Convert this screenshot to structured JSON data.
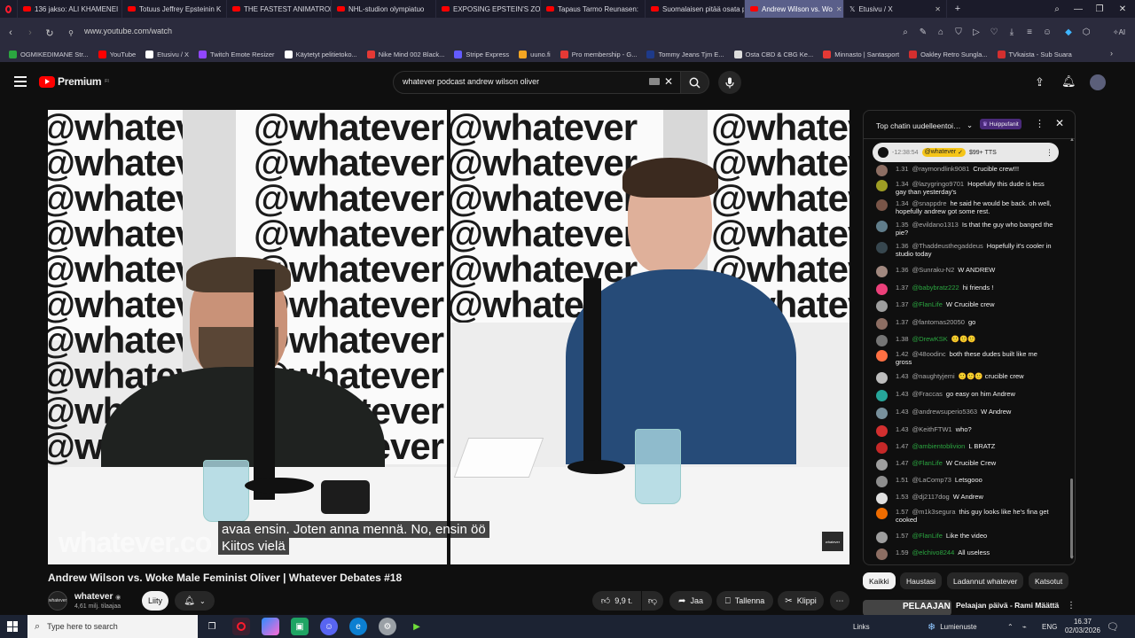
{
  "browser": {
    "tabs": [
      {
        "label": "136 jakso: ALI KHAMENEI",
        "active": false
      },
      {
        "label": "Totuus Jeffrey Epsteinin K",
        "active": false
      },
      {
        "label": "THE FASTEST ANIMATRON",
        "active": false
      },
      {
        "label": "NHL-studion olympiatuo",
        "active": false
      },
      {
        "label": "EXPOSING EPSTEIN'S ZOR",
        "active": false
      },
      {
        "label": "Tapaus Tarmo Reunasen:",
        "active": false
      },
      {
        "label": "Suomalaisen pitää osata p",
        "active": false
      },
      {
        "label": "Andrew Wilson vs. Wo",
        "active": true
      },
      {
        "label": "Etusivu / X",
        "active": false
      }
    ],
    "url": "www.youtube.com/watch",
    "bookmarks": [
      {
        "label": "OGMIKEDIMANE Str...",
        "color": "#2ba640"
      },
      {
        "label": "YouTube",
        "color": "#ff0000"
      },
      {
        "label": "Etusivu / X",
        "color": "#ffffff"
      },
      {
        "label": "Twitch Emote Resizer",
        "color": "#9146ff"
      },
      {
        "label": "Käytetyt pelitietoko...",
        "color": "#ffffff"
      },
      {
        "label": "Nike Mind 002 Black...",
        "color": "#e53935"
      },
      {
        "label": "Stripe Express",
        "color": "#635bff"
      },
      {
        "label": "uuno.fi",
        "color": "#f5a623"
      },
      {
        "label": "Pro membership - G...",
        "color": "#e53935"
      },
      {
        "label": "Tommy Jeans Tjm E...",
        "color": "#1e3a8a"
      },
      {
        "label": "Osta CBD & CBG Ke...",
        "color": "#dddddd"
      },
      {
        "label": "Minnasto | Santasport",
        "color": "#e53935"
      },
      {
        "label": "Oakley Retro Sungla...",
        "color": "#d32f2f"
      },
      {
        "label": "TVkaista - Sub Suara",
        "color": "#d32f2f"
      }
    ]
  },
  "youtube": {
    "logo_text": "Premium",
    "logo_sup": "FI",
    "search_value": "whatever podcast andrew wilson oliver"
  },
  "video": {
    "wall_text": "@whatever",
    "watermark": "whatever.co",
    "captions": [
      "avaa ensin. Joten anna mennä. No, ensin öö",
      "Kiitos vielä"
    ],
    "title": "Andrew Wilson vs. Woke Male Feminist Oliver | Whatever Debates #18",
    "channel_name": "whatever",
    "channel_avatar_text": "whatever",
    "subscribers": "4,61 milj. tilaajaa",
    "join_label": "Liity",
    "likes": "9,9 t.",
    "share_label": "Jaa",
    "save_label": "Tallenna",
    "clip_label": "Klippi",
    "corner_logo": "whatever"
  },
  "chat": {
    "header": "Top chatin uudelleentoisto",
    "header_badge": "Huippufanit",
    "pinned": {
      "time": "-12:38:54",
      "author": "@whatever",
      "text": "$99+ TTS"
    },
    "messages": [
      {
        "time": "1.31",
        "author": "@raymondlink9081",
        "text": "Crucible crew!!!",
        "color": "#8d6e63",
        "member": false
      },
      {
        "time": "1.34",
        "author": "@lazygringo9701",
        "text": "Hopefully this dude is less gay than yesterday's",
        "color": "#9e9d24",
        "member": false
      },
      {
        "time": "1.34",
        "author": "@snappdre",
        "text": "he said he would be back. oh well, hopefully andrew got some rest.",
        "color": "#795548",
        "member": false
      },
      {
        "time": "1.35",
        "author": "@evildano1313",
        "text": "Is that the guy who banged the pie?",
        "color": "#607d8b",
        "member": false
      },
      {
        "time": "1.36",
        "author": "@Thaddeusthegaddeus",
        "text": "Hopefully it's cooler in studio today",
        "color": "#37474f",
        "member": false
      },
      {
        "time": "1.36",
        "author": "@Sunraku-N2",
        "text": "W ANDREW",
        "color": "#a1887f",
        "member": false
      },
      {
        "time": "1.37",
        "author": "@babybratz222",
        "text": "hi friends !",
        "color": "#ec407a",
        "member": true
      },
      {
        "time": "1.37",
        "author": "@FlanLife",
        "text": "W Crucible crew",
        "color": "#9e9e9e",
        "member": true
      },
      {
        "time": "1.37",
        "author": "@fantomas20050",
        "text": "go",
        "color": "#8d6e63",
        "member": false
      },
      {
        "time": "1.38",
        "author": "@DrewKSK",
        "text": "🙂🙂🙂",
        "color": "#757575",
        "member": true
      },
      {
        "time": "1.42",
        "author": "@48oodinc",
        "text": "both these dudes built like me gross",
        "color": "#ff7043",
        "member": false
      },
      {
        "time": "1.43",
        "author": "@naughtyjemi",
        "text": "🙂🙂🙂 crucible crew",
        "color": "#bdbdbd",
        "member": false
      },
      {
        "time": "1.43",
        "author": "@Fraccas",
        "text": "go easy on him Andrew",
        "color": "#26a69a",
        "member": false
      },
      {
        "time": "1.43",
        "author": "@andrewsuperio5363",
        "text": "W Andrew",
        "color": "#78909c",
        "member": false
      },
      {
        "time": "1.43",
        "author": "@KeithFTW1",
        "text": "who?",
        "color": "#d32f2f",
        "member": false
      },
      {
        "time": "1.47",
        "author": "@ambientoblivion",
        "text": "L BRATZ",
        "color": "#c62828",
        "member": true
      },
      {
        "time": "1.47",
        "author": "@FlanLife",
        "text": "W Crucible Crew",
        "color": "#9e9e9e",
        "member": true
      },
      {
        "time": "1.51",
        "author": "@LaComp73",
        "text": "Letsgooo",
        "color": "#8e8e8e",
        "member": false
      },
      {
        "time": "1.53",
        "author": "@dj2117dog",
        "text": "W Andrew",
        "color": "#e0e0e0",
        "member": false
      },
      {
        "time": "1.57",
        "author": "@m1k3segura",
        "text": "this guy looks like he's fina get cooked",
        "color": "#ef6c00",
        "member": false
      },
      {
        "time": "1.57",
        "author": "@FlanLife",
        "text": "Like the video",
        "color": "#9e9e9e",
        "member": true
      },
      {
        "time": "1.59",
        "author": "@elchivo8244",
        "text": "All useless",
        "color": "#8d6e63",
        "member": true
      }
    ]
  },
  "chips": [
    "Kaikki",
    "Haustasi",
    "Ladannut whatever",
    "Katsotut"
  ],
  "recommendation": {
    "thumb_text": "PELAAJAN",
    "title": "Pelaajan päivä - Rami Määttä"
  },
  "taskbar": {
    "search_placeholder": "Type here to search",
    "links_label": "Links",
    "weather": "Lumienuste",
    "lang": "ENG",
    "time": "16.37",
    "date": "02/03/2026"
  }
}
